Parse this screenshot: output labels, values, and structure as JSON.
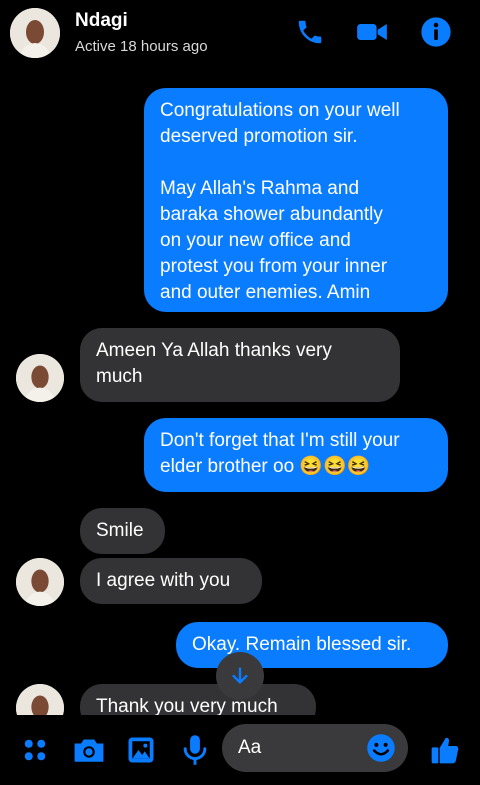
{
  "contact": {
    "name": "Ndagi",
    "status": "Active 18 hours ago"
  },
  "messages": [
    {
      "from": "me",
      "text": "Congratulations on your well\ndeserved promotion sir.\n\nMay Allah's Rahma and\nbaraka shower abundantly\non your new office and\nprotest you from your inner\nand outer enemies. Amin"
    },
    {
      "from": "them",
      "text": "Ameen Ya Allah thanks very\nmuch"
    },
    {
      "from": "me",
      "text": "Don't forget that I'm still your\nelder brother oo 😆😆😆"
    },
    {
      "from": "them",
      "text": "Smile"
    },
    {
      "from": "them",
      "text": "I agree with you"
    },
    {
      "from": "me",
      "text": "Okay. Remain blessed sir."
    },
    {
      "from": "them",
      "text": "Thank you very much"
    }
  ],
  "composer": {
    "placeholder": "Aa"
  },
  "icons": {
    "call": "phone-icon",
    "video": "video-camera-icon",
    "info": "info-icon",
    "menu": "four-dots-icon",
    "camera": "camera-icon",
    "gallery": "image-icon",
    "voice": "microphone-icon",
    "emoji": "emoji-icon",
    "like": "thumbs-up-icon",
    "scroll": "arrow-down-icon"
  },
  "colors": {
    "accent": "#0a7cff",
    "sent_bubble": "#0a7cff",
    "received_bubble": "#333335",
    "background": "#000000"
  }
}
